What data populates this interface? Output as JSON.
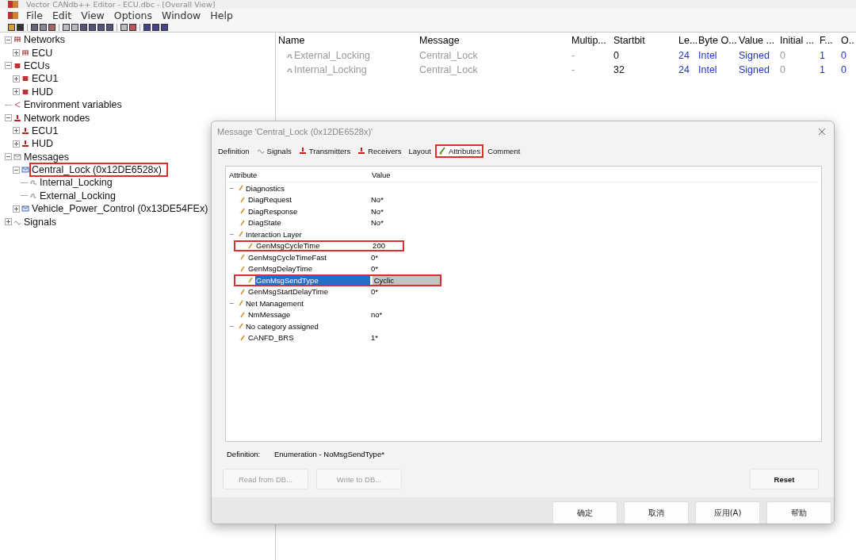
{
  "window": {
    "title": "Vector CANdb++ Editor - ECU.dbc - [Overall View]"
  },
  "menu": [
    "File",
    "Edit",
    "View",
    "Options",
    "Window",
    "Help"
  ],
  "tree": [
    {
      "label": "Networks",
      "kind": "network",
      "expanded": true,
      "highlighted": false,
      "children": [
        {
          "label": "ECU",
          "kind": "network",
          "expanded": false,
          "highlighted": false
        }
      ]
    },
    {
      "label": "ECUs",
      "kind": "ecu",
      "expanded": true,
      "highlighted": false,
      "children": [
        {
          "label": "ECU1",
          "kind": "ecu",
          "expanded": false,
          "highlighted": false
        },
        {
          "label": "HUD",
          "kind": "ecu",
          "expanded": false,
          "highlighted": false
        }
      ]
    },
    {
      "label": "Environment variables",
      "kind": "envvar",
      "highlighted": false
    },
    {
      "label": "Network nodes",
      "kind": "node",
      "expanded": true,
      "highlighted": false,
      "children": [
        {
          "label": "ECU1",
          "kind": "node",
          "expanded": false,
          "highlighted": false
        },
        {
          "label": "HUD",
          "kind": "node",
          "expanded": false,
          "highlighted": false
        }
      ]
    },
    {
      "label": "Messages",
      "kind": "messages",
      "expanded": true,
      "highlighted": false,
      "children": [
        {
          "label": "Central_Lock (0x12DE6528x)",
          "kind": "message",
          "expanded": true,
          "highlighted": true,
          "children": [
            {
              "label": "Internal_Locking",
              "kind": "signal",
              "highlighted": false
            },
            {
              "label": "External_Locking",
              "kind": "signal",
              "highlighted": false
            }
          ]
        },
        {
          "label": "Vehicle_Power_Control (0x13DE54FEx)",
          "kind": "message",
          "expanded": false,
          "highlighted": false
        }
      ]
    },
    {
      "label": "Signals",
      "kind": "signals",
      "expanded": false,
      "highlighted": false
    }
  ],
  "table": {
    "columns": [
      "Name",
      "Message",
      "Multip...",
      "Startbit",
      "Le...",
      "Byte O...",
      "Value ...",
      "Initial ...",
      "F...",
      "O..."
    ],
    "rows": [
      [
        "External_Locking",
        "Central_Lock",
        "-",
        "0",
        "24",
        "Intel",
        "Signed",
        "0",
        "1",
        "0"
      ],
      [
        "Internal_Locking",
        "Central_Lock",
        "-",
        "32",
        "24",
        "Intel",
        "Signed",
        "0",
        "1",
        "0"
      ]
    ]
  },
  "dialog": {
    "title": "Message 'Central_Lock (0x12DE6528x)'",
    "tabs": [
      {
        "label": "Definition",
        "kind": "plain",
        "selected": false,
        "highlighted": false
      },
      {
        "label": "Signals",
        "kind": "signals",
        "selected": false,
        "highlighted": false
      },
      {
        "label": "Transmitters",
        "kind": "node",
        "selected": false,
        "highlighted": false
      },
      {
        "label": "Receivers",
        "kind": "node",
        "selected": false,
        "highlighted": false
      },
      {
        "label": "Layout",
        "kind": "plain",
        "selected": false,
        "highlighted": false
      },
      {
        "label": "Attributes",
        "kind": "attr",
        "selected": true,
        "highlighted": true
      },
      {
        "label": "Comment",
        "kind": "plain",
        "selected": false,
        "highlighted": false
      }
    ],
    "attribute_header": "Attribute",
    "value_header": "Value",
    "attributes": [
      {
        "label": "Diagnostics",
        "children": [
          {
            "label": "DiagRequest",
            "value": "No*",
            "selected": false,
            "highlighted": false
          },
          {
            "label": "DiagResponse",
            "value": "No*",
            "selected": false,
            "highlighted": false
          },
          {
            "label": "DiagState",
            "value": "No*",
            "selected": false,
            "highlighted": false
          }
        ]
      },
      {
        "label": "Interaction Layer",
        "children": [
          {
            "label": "GenMsgCycleTime",
            "value": "200",
            "selected": false,
            "highlighted": true
          },
          {
            "label": "GenMsgCycleTimeFast",
            "value": "0*",
            "selected": false,
            "highlighted": false
          },
          {
            "label": "GenMsgDelayTime",
            "value": "0*",
            "selected": false,
            "highlighted": false
          },
          {
            "label": "GenMsgSendType",
            "value": "Cyclic",
            "selected": true,
            "highlighted": true
          },
          {
            "label": "GenMsgStartDelayTime",
            "value": "0*",
            "selected": false,
            "highlighted": false
          }
        ]
      },
      {
        "label": "Net Management",
        "children": [
          {
            "label": "NmMessage",
            "value": "no*",
            "selected": false,
            "highlighted": false
          }
        ]
      },
      {
        "label": "No category assigned",
        "children": [
          {
            "label": "CANFD_BRS",
            "value": "1*",
            "selected": false,
            "highlighted": false
          }
        ]
      }
    ],
    "definition_label": "Definition:",
    "definition_value": "Enumeration - NoMsgSendType*",
    "buttons": [
      {
        "label": "Read from DB...",
        "disabled": true
      },
      {
        "label": "Write to DB...",
        "disabled": true
      },
      {
        "label": "Reset",
        "disabled": false
      }
    ],
    "footer_buttons": [
      "确定",
      "取消",
      "应用(A)",
      "帮助"
    ]
  }
}
